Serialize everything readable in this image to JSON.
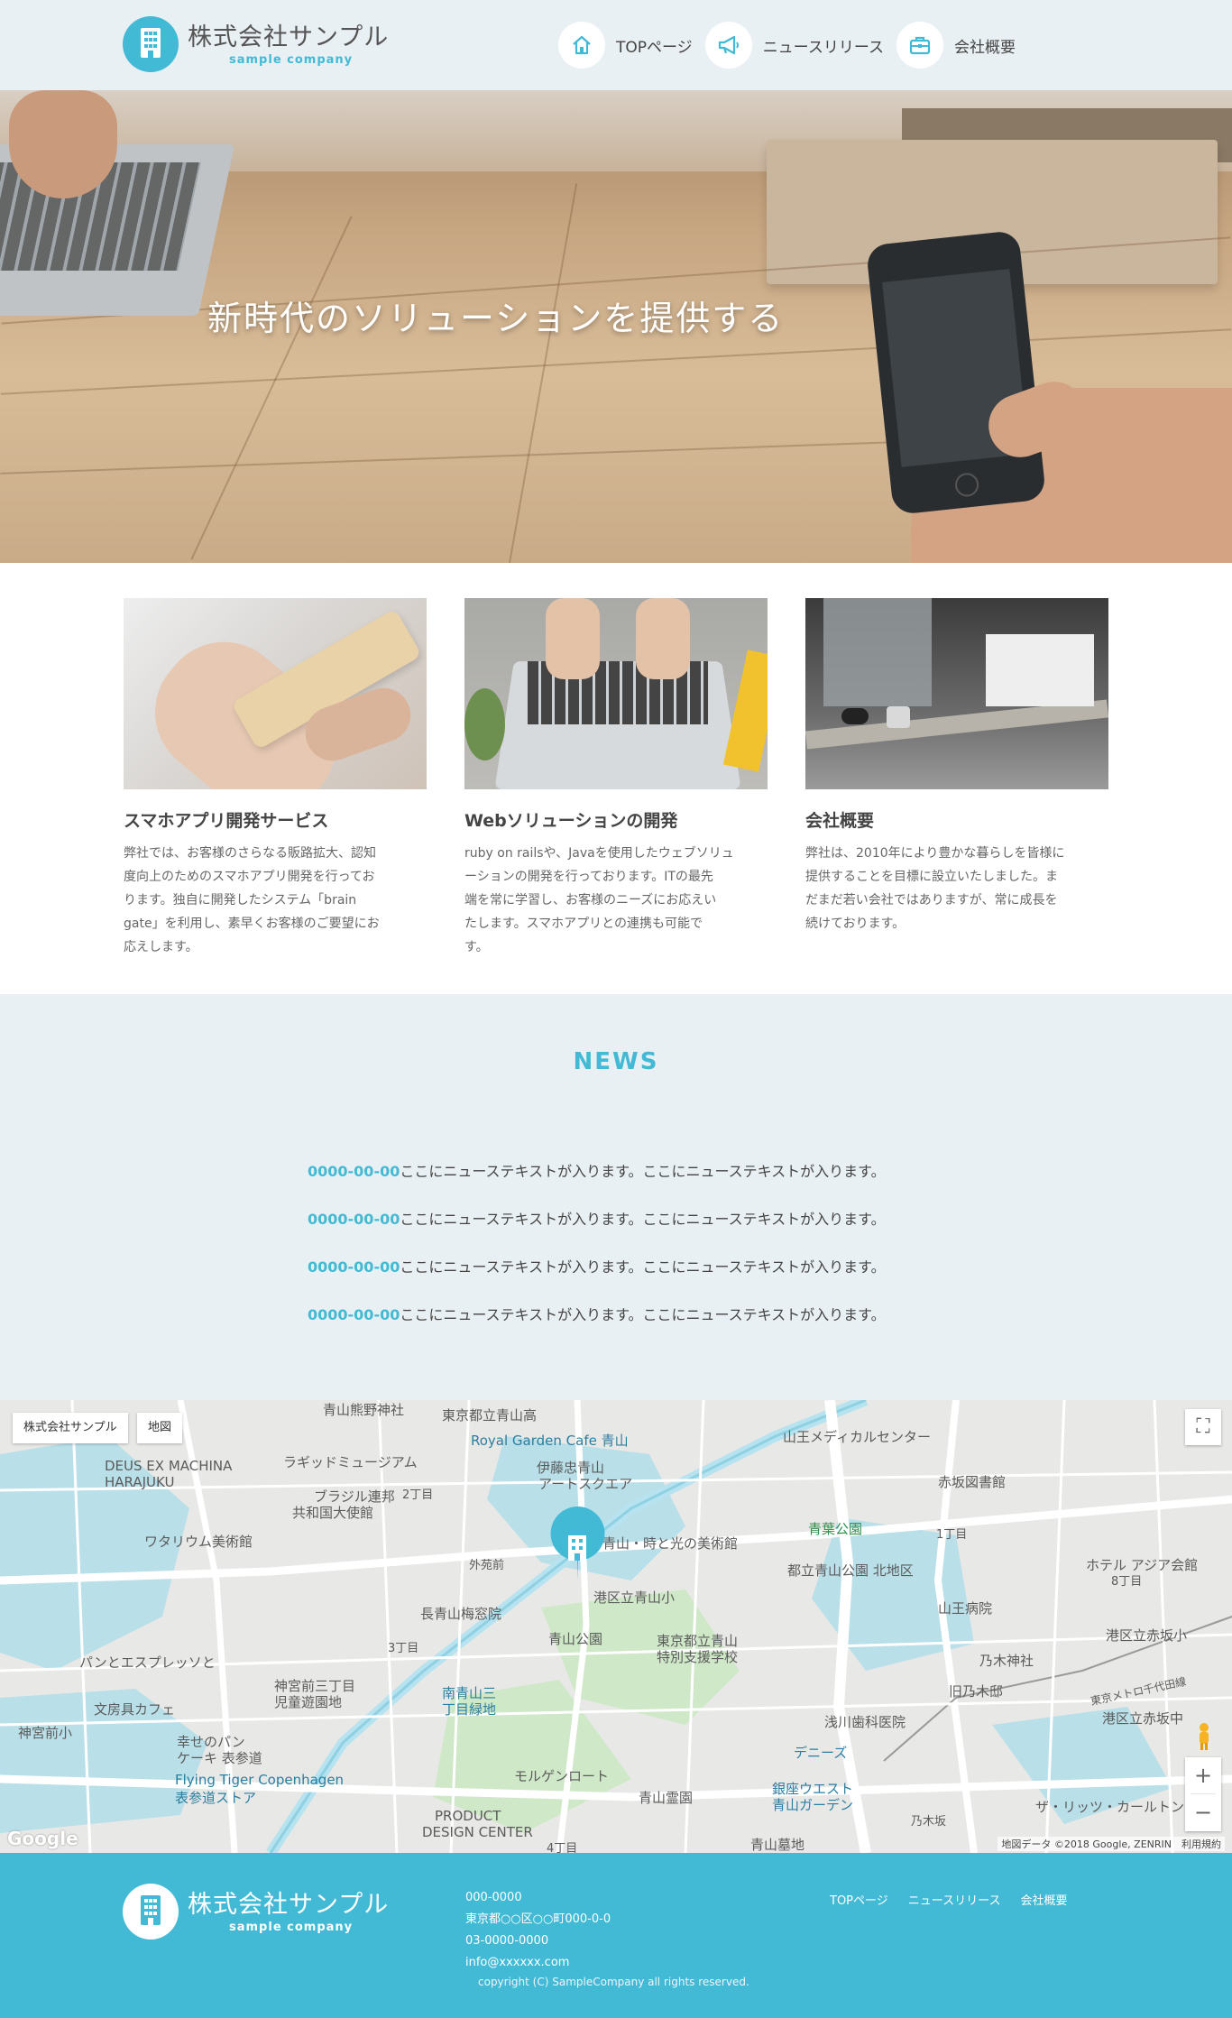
{
  "header": {
    "logo_name": "株式会社サンプル",
    "logo_sub": "sample company",
    "nav": [
      {
        "label": "TOPページ",
        "icon": "home-icon"
      },
      {
        "label": "ニュースリリース",
        "icon": "megaphone-icon"
      },
      {
        "label": "会社概要",
        "icon": "briefcase-icon"
      }
    ]
  },
  "hero": {
    "title": "新時代のソリューションを提供する"
  },
  "services": [
    {
      "title": "スマホアプリ開発サービス",
      "lines": [
        "弊社では、お客様のさらなる販路拡大、認知",
        "度向上のためのスマホアプリ開発を行ってお",
        "ります。独自に開発したシステム「brain",
        "gate」を利用し、素早くお客様のご要望にお",
        "応えします。"
      ]
    },
    {
      "title": "Webソリューションの開発",
      "lines": [
        "ruby on railsや、Javaを使用したウェブソリュ",
        "ーションの開発を行っております。ITの最先",
        "端を常に学習し、お客様のニーズにお応えい",
        "たします。スマホアプリとの連携も可能で",
        "す。"
      ]
    },
    {
      "title": "会社概要",
      "lines": [
        "弊社は、2010年により豊かな暮らしを皆様に",
        "提供することを目標に設立いたしました。ま",
        "だまだ若い会社ではありますが、常に成長を",
        "続けております。"
      ]
    }
  ],
  "news": {
    "heading": "NEWS",
    "items": [
      {
        "date": "0000-00-00",
        "text": "ここにニューステキストが入ります。ここにニューステキストが入ります。"
      },
      {
        "date": "0000-00-00",
        "text": "ここにニューステキストが入ります。ここにニューステキストが入ります。"
      },
      {
        "date": "0000-00-00",
        "text": "ここにニューステキストが入ります。ここにニューステキストが入ります。"
      },
      {
        "date": "0000-00-00",
        "text": "ここにニューステキストが入ります。ここにニューステキストが入ります。"
      }
    ]
  },
  "map": {
    "tab_place": "株式会社サンプル",
    "tab_map": "地図",
    "fullscreen": "⛶",
    "zoom_in": "+",
    "zoom_out": "−",
    "attribution": "地図データ ©2018 Google, ZENRIN　利用規約",
    "google": "Google",
    "labels": [
      "青山熊野神社",
      "東京都立青山高",
      "Royal Garden Cafe 青山",
      "山王メディカルセンター",
      "DEUS EX MACHINA",
      "HARAJUKU",
      "ラギッドミュージアム",
      "伊藤忠青山",
      "アートスクエア",
      "赤坂図書館",
      "ブラジル連邦",
      "共和国大使館",
      "ワタリウム美術館",
      "青山・時と光の美術館",
      "青葉公園",
      "都立青山公園 北地区",
      "港区立青山小",
      "青山公園",
      "長青山梅窓院",
      "山王病院",
      "ホテル アジア会館",
      "東京都立青山",
      "特別支援学校",
      "乃木神社",
      "パンとエスプレッソと",
      "神宮前三丁目",
      "児童遊園地",
      "南青山三",
      "丁目緑地",
      "旧乃木邸",
      "港区立赤坂小",
      "文房具カフェ",
      "浅川歯科医院",
      "港区立赤坂中",
      "神宮前小",
      "幸せのパン",
      "ケーキ 表参道",
      "デニーズ",
      "モルゲンロート",
      "Flying Tiger Copenhagen",
      "表参道ストア",
      "青山霊園",
      "銀座ウエスト",
      "青山ガーデン",
      "PRODUCT",
      "DESIGN CENTER",
      "ザ・リッツ・カールトン",
      "東京メトロ千代田線",
      "外苑前",
      "乃木坂",
      "青山墓地",
      "1丁目",
      "2丁目",
      "8丁目",
      "4丁目",
      "3丁目"
    ]
  },
  "footer": {
    "logo_name": "株式会社サンプル",
    "logo_sub": "sample company",
    "info": [
      "000-0000",
      "東京都○○区○○町000-0-0",
      "03-0000-0000",
      "info@xxxxxx.com"
    ],
    "copyright": "copyright (C) SampleCompany all rights reserved.",
    "nav": [
      "TOPページ",
      "ニュースリリース",
      "会社概要"
    ]
  },
  "colors": {
    "accent": "#43bad5",
    "header_bg": "#e9f0f3",
    "text": "#444444"
  }
}
